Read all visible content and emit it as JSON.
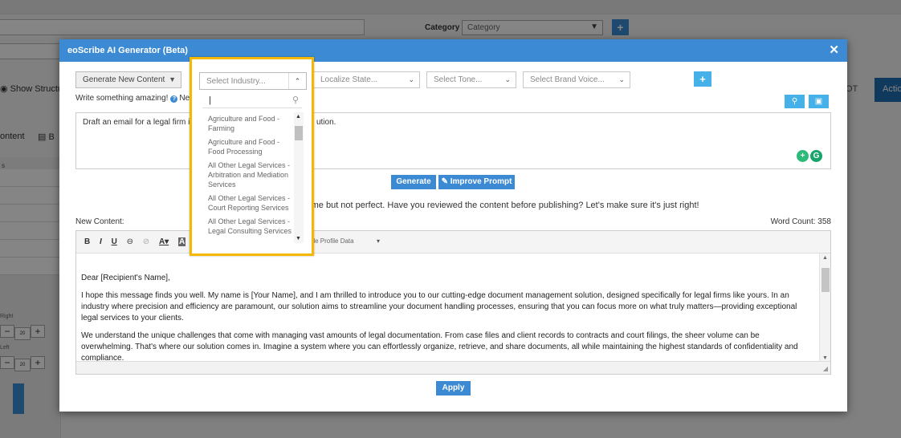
{
  "background": {
    "category_label": "Category",
    "category_select": "Category",
    "show_structure": "Show Structu",
    "ot_text": "OT",
    "action_button": "Actio",
    "content_tab": "ontent",
    "b_text": "B",
    "side_section": "s",
    "right_label": "Right",
    "left_label": "Left",
    "stepper_minus": "−",
    "stepper_value": "20",
    "stepper_plus": "+"
  },
  "modal": {
    "title": "eoScribe AI Generator (Beta)",
    "close_glyph": "✕",
    "content_type": "Generate New Content",
    "industry_placeholder": "Select Industry...",
    "localize_placeholder": "Localize State...",
    "tone_placeholder": "Select Tone...",
    "brand_voice_placeholder": "Select Brand Voice...",
    "add_glyph": "+",
    "write_label": "Write something amazing!",
    "help_label": "Need Help?",
    "prompt_text_start": "Draft an email for a legal firm introduci",
    "prompt_text_end": "ution.",
    "generate_button": "Generate",
    "improve_button": "Improve Prompt",
    "notice_text": "some but not perfect. Have you reviewed the content before publishing? Let's make sure it's just right!",
    "new_content_label": "New Content:",
    "word_count_label": "Word Count: 358",
    "variable_profile": "riable Profile Data",
    "apply_button": "Apply"
  },
  "editor": {
    "paragraphs": [
      "Dear [Recipient's Name],",
      "I hope this message finds you well. My name is [Your Name], and I am thrilled to introduce you to our cutting-edge document management solution, designed specifically for legal firms like yours. In an industry where precision and efficiency are paramount, our solution aims to streamline your document handling processes, ensuring that you can focus more on what truly matters—providing exceptional legal services to your clients.",
      "We understand the unique challenges that come with managing vast amounts of legal documentation. From case files and client records to contracts and court filings, the sheer volume can be overwhelming. That's where our solution comes in. Imagine a system where you can effortlessly organize, retrieve, and share documents, all while maintaining the highest standards of confidentiality and compliance."
    ]
  },
  "industry_dropdown": {
    "search_value": "",
    "options": [
      "Agriculture and Food - Farming",
      "Agriculture and Food - Food Processing",
      "All Other Legal Services - Arbitration and Mediation Services",
      "All Other Legal Services - Court Reporting Services",
      "All Other Legal Services - Legal Consulting Services"
    ]
  },
  "colors": {
    "header_blue": "#3c8ad4",
    "highlight_yellow": "#f5b800",
    "light_blue_button": "#45b1e8"
  }
}
